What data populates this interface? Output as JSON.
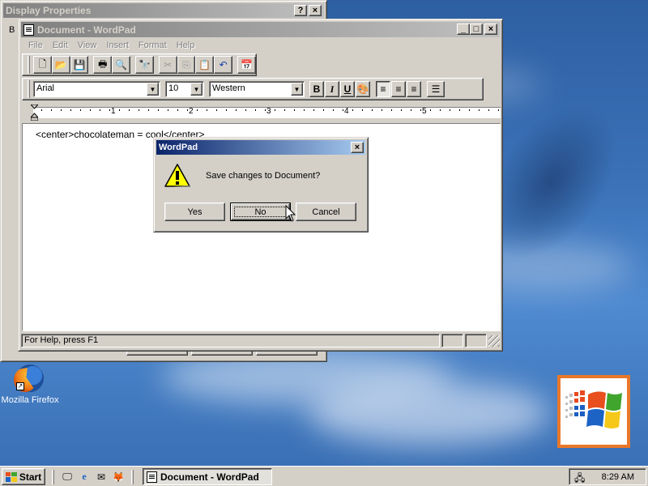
{
  "display_properties": {
    "title": "Display Properties",
    "tab_hint": "B",
    "help_label": "?",
    "close_label": "×"
  },
  "wordpad": {
    "title": "Document - WordPad",
    "menu": [
      "File",
      "Edit",
      "View",
      "Insert",
      "Format",
      "Help"
    ],
    "font_name": "Arial",
    "font_size": "10",
    "script": "Western",
    "document_text": "<center>chocolateman = cool</center>",
    "status_text": "For Help, press F1",
    "ruler_numbers": [
      "1",
      "2",
      "3",
      "4",
      "5"
    ],
    "min_label": "_",
    "max_label": "□",
    "close_label": "×",
    "font_arrow": "▼"
  },
  "dialog": {
    "title": "WordPad",
    "message": "Save changes to Document?",
    "yes": "Yes",
    "no": "No",
    "cancel": "Cancel",
    "close_label": "×",
    "focused_button": "No"
  },
  "desktop": {
    "icons": [
      {
        "label": "Mozilla Firefox",
        "icon": "firefox-icon"
      }
    ]
  },
  "taskbar": {
    "start_label": "Start",
    "quick_launch": [
      "show-desktop-icon",
      "internet-explorer-icon",
      "outlook-icon",
      "firefox-icon"
    ],
    "task_label": "Document - WordPad",
    "clock": "8:29 AM"
  },
  "colors": {
    "active_title_start": "#0a246a",
    "active_title_end": "#a6caf0",
    "inactive_title": "#808080",
    "face": "#d4d0c8",
    "desktop": "#3a6ea5",
    "logo_border": "#e9782a"
  }
}
